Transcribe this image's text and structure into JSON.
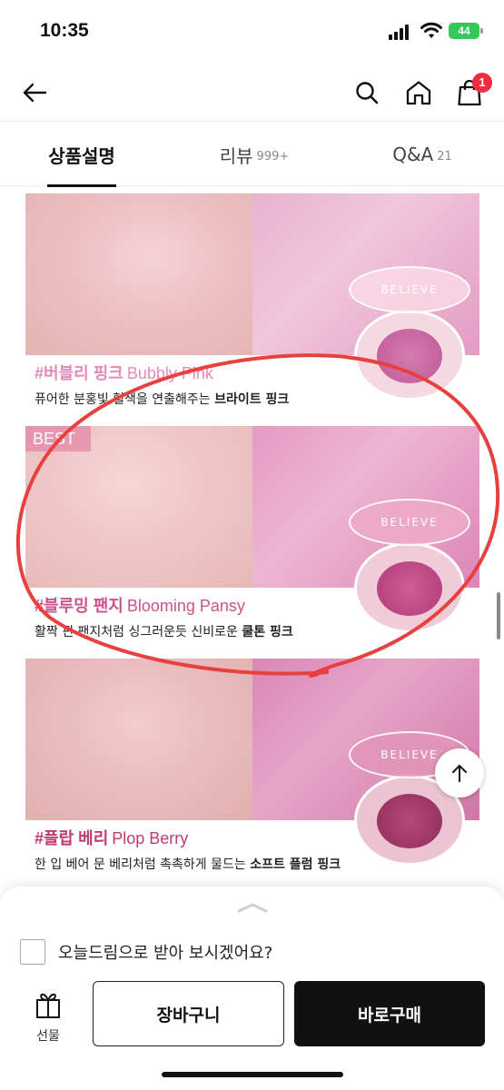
{
  "status_bar": {
    "time": "10:35",
    "battery": "44"
  },
  "header": {
    "cart_count": "1"
  },
  "tabs": [
    {
      "label": "상품설명",
      "count": ""
    },
    {
      "label": "리뷰",
      "count": "999+"
    },
    {
      "label": "Q&A",
      "count": "21"
    }
  ],
  "products": [
    {
      "name_kr": "#버블리 핑크",
      "name_en": "Bubbly Pink",
      "desc_prefix": "퓨어한 분홍빛 혈색을 연출해주는 ",
      "desc_bold": "브라이트 핑크",
      "badge": "",
      "accent": "#e28ab8"
    },
    {
      "name_kr": "#블루밍 팬지",
      "name_en": "Blooming Pansy",
      "desc_prefix": "활짝 핀 팬지처럼 싱그러운듯 신비로운 ",
      "desc_bold": "쿨톤 핑크",
      "badge": "BEST",
      "accent": "#c9538c"
    },
    {
      "name_kr": "#플랍 베리",
      "name_en": "Plop Berry",
      "desc_prefix": "한 입 베어 문 베리처럼 촉촉하게 물드는 ",
      "desc_bold": "소프트 플럼 핑크",
      "badge": "",
      "accent": "#c03a6f"
    }
  ],
  "compact_lid_text": "BELIEVE",
  "bottom_sheet": {
    "delivery_option": "오늘드림으로 받아 보시겠어요?",
    "gift_label": "선물",
    "cart_button": "장바구니",
    "buy_button": "바로구매"
  },
  "colors": {
    "badge": "#ef2d3e",
    "annotation": "#e8403f",
    "buy_bg": "#111111"
  }
}
